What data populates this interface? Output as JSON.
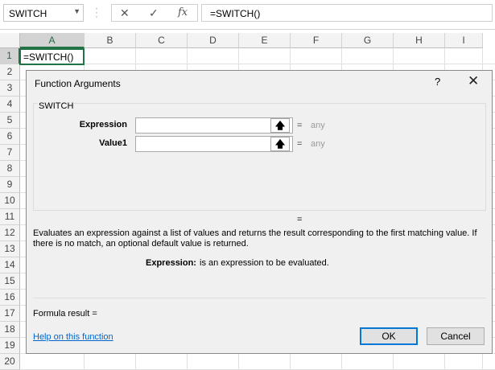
{
  "formula_bar": {
    "name_box": "SWITCH",
    "cancel_glyph": "✕",
    "enter_glyph": "✓",
    "fx_label": "fx",
    "formula": "=SWITCH()"
  },
  "grid": {
    "columns": [
      "A",
      "B",
      "C",
      "D",
      "E",
      "F",
      "G",
      "H",
      "I"
    ],
    "rows": [
      "1",
      "2",
      "3",
      "4",
      "5",
      "6",
      "7",
      "8",
      "9",
      "10",
      "11",
      "12",
      "13",
      "14",
      "15",
      "16",
      "17",
      "18",
      "19",
      "20"
    ],
    "selected_column": "A",
    "selected_row": "1",
    "active_cell_text": "=SWITCH()"
  },
  "dialog": {
    "title": "Function Arguments",
    "help_glyph": "?",
    "close_glyph": "✕",
    "group_name": "SWITCH",
    "args": [
      {
        "label": "Expression",
        "equals": "=",
        "value": "any"
      },
      {
        "label": "Value1",
        "equals": "=",
        "value": "any"
      }
    ],
    "ref_glyph": "🡅",
    "result_equals": "=",
    "description": "Evaluates an expression against a list of values and returns the result corresponding to the first matching value. If there is no match, an optional default value is returned.",
    "detail_label": "Expression:",
    "detail_text": "is an expression to be evaluated.",
    "formula_result": "Formula result =",
    "help_link": "Help on this function",
    "ok_label": "OK",
    "cancel_label": "Cancel"
  },
  "colors": {
    "accent_green": "#217346",
    "link_blue": "#0066cc",
    "focus_blue": "#0078d7"
  },
  "icons": [
    "dropdown-arrow-icon",
    "cancel-icon",
    "enter-icon",
    "fx-icon",
    "help-icon",
    "close-icon",
    "range-select-icon"
  ]
}
